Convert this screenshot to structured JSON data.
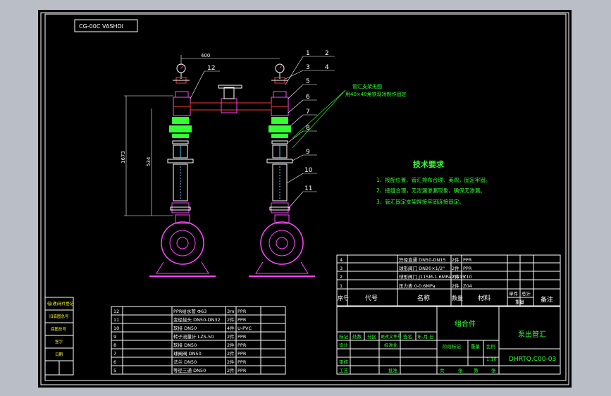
{
  "drawing": {
    "code_box": "CG-00C VASHDI",
    "dim_top": "400",
    "dim_left_outer": "1673",
    "dim_left_inner": "534",
    "note_support_line1": "管汇支架无图",
    "note_support_line2": "用40×40角铁现场制作固定",
    "leaders": [
      "1",
      "2",
      "3",
      "4",
      "5",
      "6",
      "7",
      "8",
      "9",
      "10",
      "11",
      "12"
    ],
    "tech_title": "技术要求",
    "tech_items": [
      "1、按配位置、管汇排布合理、美观，固定牢固。",
      "2、接缝合理，无泄漏渗漏现象，确保无渗漏。",
      "3、管汇固定支架焊接牢固连接固定。"
    ]
  },
  "upper_bom": {
    "rows": [
      {
        "no": "4",
        "name": "异径直通 DN50-DN15",
        "qty": "2件",
        "mat": "PPR"
      },
      {
        "no": "3",
        "name": "球形阀门 DN20×1/2\"",
        "qty": "2件",
        "mat": "PPR"
      },
      {
        "no": "2",
        "name": "球形阀门 J11SM-1.6MPa DN15",
        "qty": "2件",
        "mat": "Z10"
      },
      {
        "no": "1",
        "name": "压力表 0-0.6MPa",
        "qty": "2件",
        "mat": "Z04"
      }
    ],
    "header": {
      "no": "序号",
      "code": "代号",
      "name": "名称",
      "qty": "数量",
      "mat": "材料",
      "unit_weight": "单件",
      "total_weight": "总计",
      "weight": "重量",
      "note": "备注"
    }
  },
  "lower_bom": {
    "rows": [
      {
        "no": "12",
        "name": "PPR给水管 Φ63",
        "qty": "3m",
        "mat": "PPR"
      },
      {
        "no": "11",
        "name": "变径接头 DN50-DN32",
        "qty": "2件",
        "mat": "PPR"
      },
      {
        "no": "10",
        "name": "软接 DN50",
        "qty": "4件",
        "mat": "U-PVC"
      },
      {
        "no": "9",
        "name": "转子流量计 LZS-50",
        "qty": "2件",
        "mat": "PPR"
      },
      {
        "no": "8",
        "name": "软接 DN50",
        "qty": "2件",
        "mat": "PPR"
      },
      {
        "no": "7",
        "name": "球阀阀 DN50",
        "qty": "2件",
        "mat": "PPR"
      },
      {
        "no": "6",
        "name": "法兰 DN50",
        "qty": "2件",
        "mat": "PPR"
      },
      {
        "no": "5",
        "name": "等径三通 DN50",
        "qty": "2件",
        "mat": "PPR"
      }
    ]
  },
  "title_block": {
    "assembly": "组合件",
    "drawing_name": "泵出管汇",
    "drawing_no": "DHRTQ.C00-03",
    "scale": "1:10",
    "labels": {
      "mark": "标记",
      "count": "处数",
      "zone": "分区",
      "change_doc": "更改文件号",
      "sign": "签名",
      "date": "年.月.日",
      "design": "设计",
      "standardize": "标准化",
      "stage_mark": "阶段标记",
      "weight": "重量",
      "scale": "比例",
      "review": "审核",
      "process": "工艺",
      "approve": "批准",
      "total_sheets": "共",
      "sheet": "张",
      "this_sheet": "第"
    }
  },
  "side_table": {
    "rows": [
      "借(通)用件登记",
      "旧底图总号",
      "底图总号",
      "签字",
      "日期"
    ]
  }
}
